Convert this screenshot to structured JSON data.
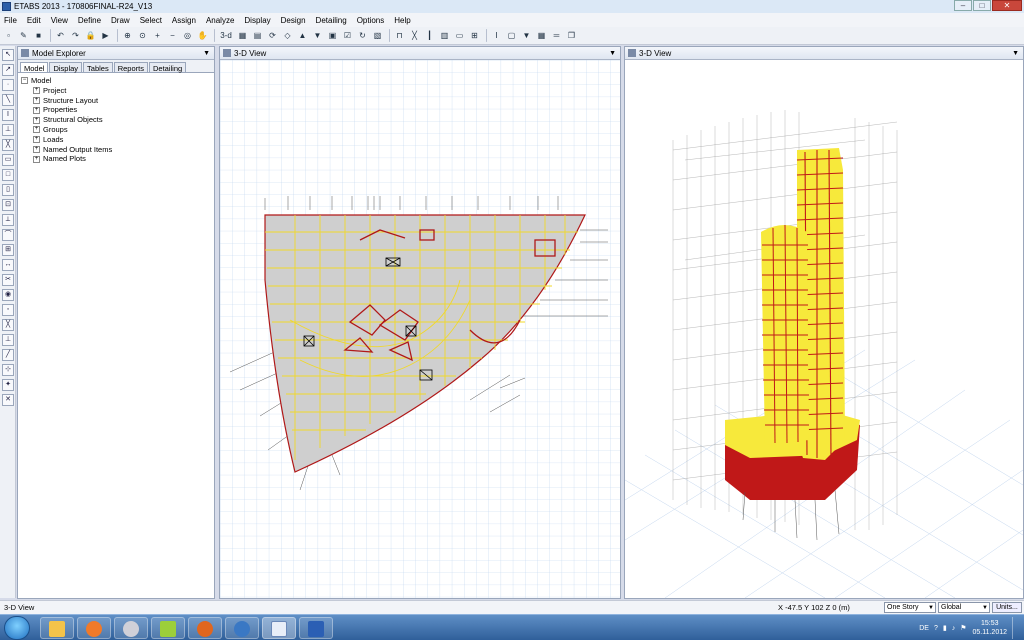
{
  "window": {
    "title": "ETABS 2013 - 170806FINAL-R24_V13"
  },
  "menu": [
    "File",
    "Edit",
    "View",
    "Define",
    "Draw",
    "Select",
    "Assign",
    "Analyze",
    "Display",
    "Design",
    "Detailing",
    "Options",
    "Help"
  ],
  "toolbar": {
    "view_3d_label": "3-d"
  },
  "explorer": {
    "title": "Model Explorer",
    "tabs": [
      "Model",
      "Display",
      "Tables",
      "Reports",
      "Detailing"
    ],
    "root": "Model",
    "items": [
      "Project",
      "Structure Layout",
      "Properties",
      "Structural Objects",
      "Groups",
      "Loads",
      "Named Output Items",
      "Named Plots"
    ]
  },
  "view1": {
    "title": "3-D View"
  },
  "view2": {
    "title": "3-D View"
  },
  "status": {
    "left": "3-D View",
    "coords": "X -47.5  Y 102  Z 0  (m)",
    "story_select": "One Story",
    "coord_system": "Global",
    "units_button": "Units..."
  },
  "taskbar": {
    "lang": "DE",
    "time": "15:53",
    "date": "05.11.2012",
    "apps": [
      "explorer",
      "media-player",
      "tool",
      "green-app",
      "firefox",
      "settings",
      "etabs",
      "word"
    ]
  },
  "colors": {
    "frame_yellow": "#f7e93b",
    "frame_red": "#c01818",
    "slab_gray": "#cfcfcf",
    "grid_blue": "#bcd3ee"
  }
}
